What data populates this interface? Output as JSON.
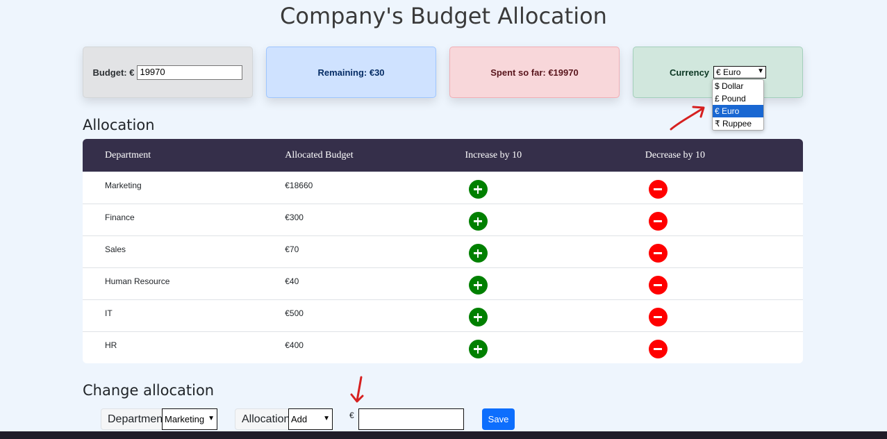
{
  "title": "Company's Budget Allocation",
  "cards": {
    "budget_label": "Budget: €",
    "budget_value": "19970",
    "remaining": "Remaining: €30",
    "spent": "Spent so far: €19970",
    "currency_label": "Currency",
    "currency_selected": "€ Euro"
  },
  "currency_options": [
    "$ Dollar",
    "£ Pound",
    "€ Euro",
    "₹ Ruppee"
  ],
  "allocation": {
    "heading": "Allocation",
    "columns": [
      "Department",
      "Allocated Budget",
      "Increase by 10",
      "Decrease by 10"
    ],
    "rows": [
      {
        "department": "Marketing",
        "budget": "€18660"
      },
      {
        "department": "Finance",
        "budget": "€300"
      },
      {
        "department": "Sales",
        "budget": "€70"
      },
      {
        "department": "Human Resource",
        "budget": "€40"
      },
      {
        "department": "IT",
        "budget": "€500"
      },
      {
        "department": "HR",
        "budget": "€400"
      }
    ]
  },
  "change": {
    "heading": "Change allocation",
    "department_label": "Department",
    "department_value": "Marketing",
    "allocation_label": "Allocation",
    "allocation_value": "Add",
    "currency_sign": "€",
    "amount_value": "",
    "save_label": "Save"
  },
  "colors": {
    "header_bg": "#352f4a",
    "increase": "#008000",
    "decrease": "#ff0000",
    "save": "#0d6efd",
    "annotation": "#d62020"
  },
  "icons": [
    "plus-icon",
    "minus-icon",
    "chevron-down-icon"
  ]
}
